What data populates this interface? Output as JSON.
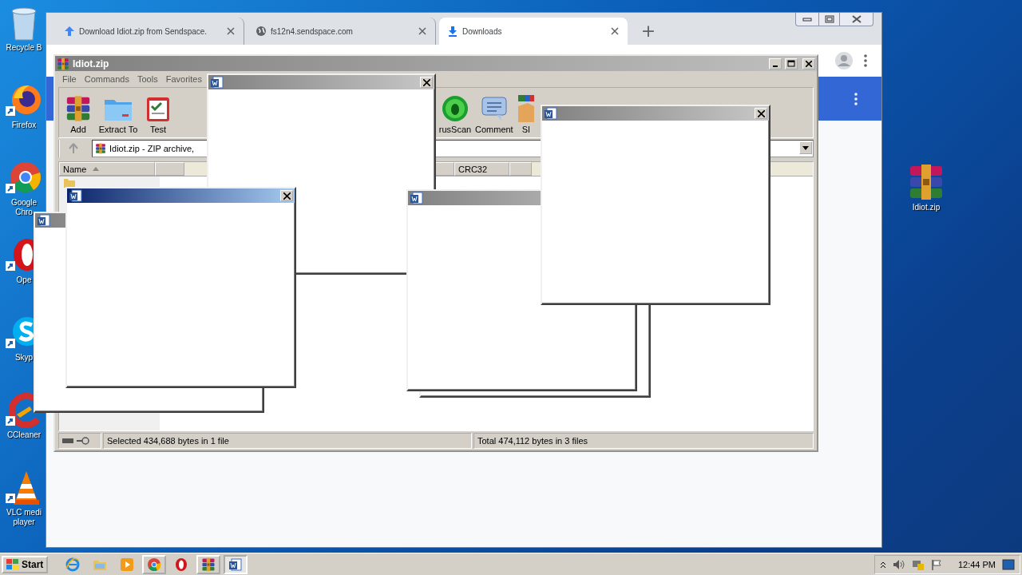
{
  "desktop": {
    "icons": [
      {
        "kind": "recycle",
        "label": "Recycle B"
      },
      {
        "kind": "firefox",
        "label": "Firefox"
      },
      {
        "kind": "chrome",
        "label": "Google Chro"
      },
      {
        "kind": "opera",
        "label": "Ope"
      },
      {
        "kind": "skype",
        "label": "Skyp"
      },
      {
        "kind": "ccleaner",
        "label": "CCleaner"
      },
      {
        "kind": "vlc",
        "label": "VLC medi player"
      }
    ],
    "right_icons": [
      {
        "kind": "winrar",
        "label": "Idiot.zip"
      }
    ]
  },
  "browser": {
    "tabs": [
      {
        "kind": "upload",
        "title": "Download Idiot.zip from Sendspace.",
        "selected": false
      },
      {
        "kind": "site",
        "title": "fs12n4.sendspace.com",
        "selected": false
      },
      {
        "kind": "download",
        "title": "Downloads",
        "selected": true
      }
    ],
    "new_tab": "+"
  },
  "winrar": {
    "title": "Idiot.zip",
    "active": false,
    "menu": [
      "File",
      "Commands",
      "Tools",
      "Favorites"
    ],
    "toolbar_left": [
      {
        "kind": "add",
        "label": "Add"
      },
      {
        "kind": "extract",
        "label": "Extract To"
      },
      {
        "kind": "test",
        "label": "Test"
      }
    ],
    "toolbar_right": [
      {
        "kind": "virus",
        "label": "rusScan"
      },
      {
        "kind": "comment",
        "label": "Comment"
      },
      {
        "kind": "sfx",
        "label": "Sl"
      }
    ],
    "path": "Idiot.zip - ZIP archive,",
    "columns": [
      "Name",
      "CRC32"
    ],
    "status": [
      "Selected 434,688 bytes in 1 file",
      "Total 474,112 bytes in 3 files"
    ]
  },
  "popups": [
    {
      "kind": "window",
      "active": false,
      "close_button": true
    },
    {
      "kind": "window",
      "active": false
    },
    {
      "kind": "window",
      "active": true,
      "close_button": true
    },
    {
      "kind": "frame"
    },
    {
      "kind": "window",
      "active": false
    },
    {
      "kind": "window",
      "active": false,
      "close_button": true
    }
  ],
  "taskbar": {
    "start": "Start",
    "apps": [
      {
        "kind": "ie",
        "open": false,
        "selected": false
      },
      {
        "kind": "explorer",
        "open": false,
        "selected": false
      },
      {
        "kind": "media",
        "open": false,
        "selected": false
      },
      {
        "kind": "chrome",
        "open": true,
        "selected": false
      },
      {
        "kind": "opera",
        "open": false,
        "selected": false
      },
      {
        "kind": "winrar",
        "open": true,
        "selected": false
      },
      {
        "kind": "word",
        "open": true,
        "selected": true
      }
    ],
    "clock": "12:44 PM"
  }
}
